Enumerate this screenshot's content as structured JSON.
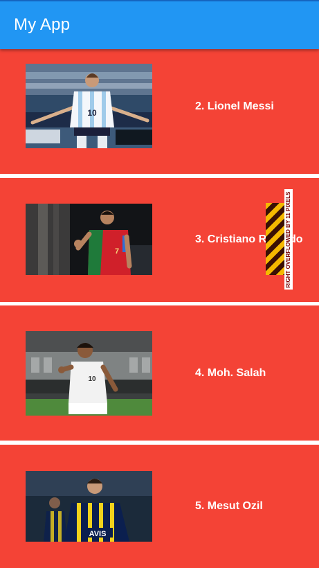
{
  "appbar": {
    "title": "My App"
  },
  "players": [
    {
      "label": "2. Lionel Messi",
      "jersey": "10",
      "colors": [
        "#c9e4f7",
        "#ffffff",
        "#1b1f3a"
      ]
    },
    {
      "label": "3. Cristiano Ronaldo",
      "jersey": "7",
      "colors": [
        "#d0202a",
        "#1f7a3a"
      ]
    },
    {
      "label": "4. Moh. Salah",
      "jersey": "10",
      "colors": [
        "#f0f0f0",
        "#3b7d3b"
      ]
    },
    {
      "label": "5. Mesut Ozil",
      "jersey": "",
      "colors": [
        "#0b1f4f",
        "#f2d21b"
      ]
    }
  ],
  "overflow_warning": {
    "text": "RIGHT OVERFLOWED BY 11 PIXELS"
  },
  "colors": {
    "appbar": "#2196f3",
    "card": "#f44336",
    "divider": "#ffffff"
  }
}
